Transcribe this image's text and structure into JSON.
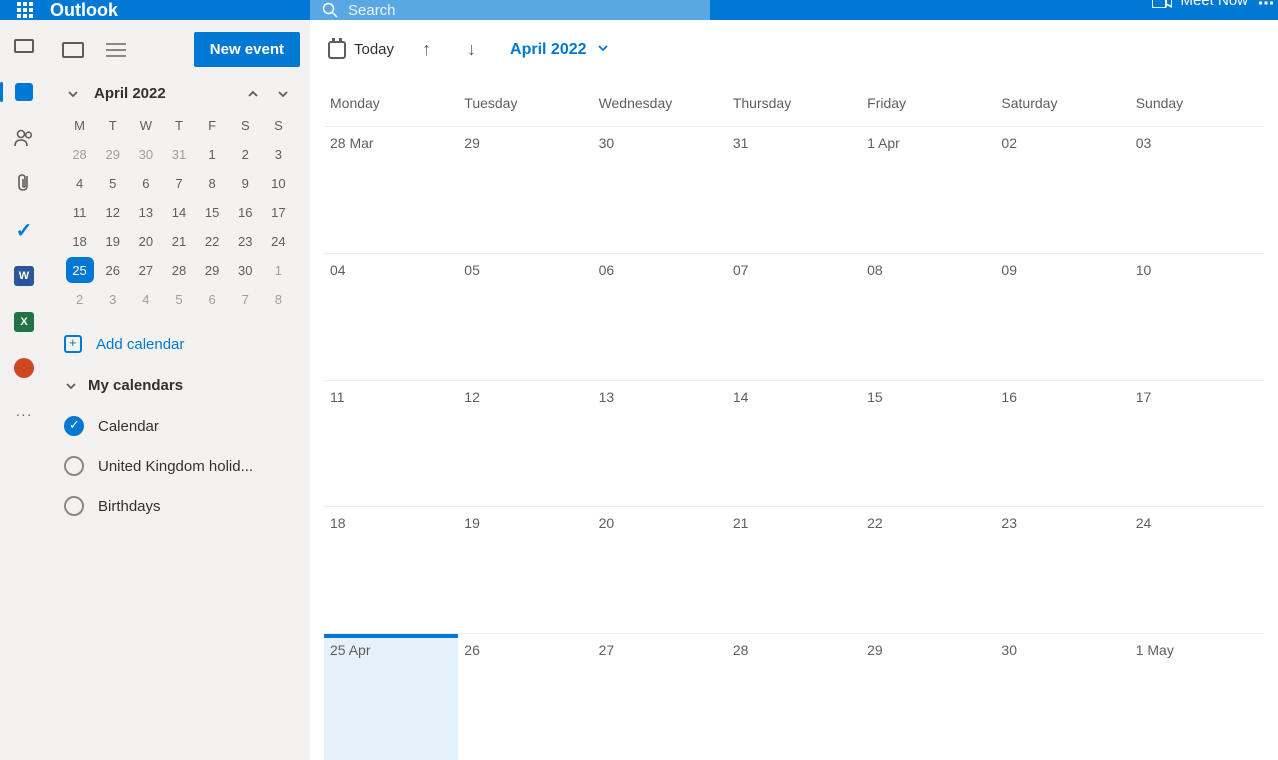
{
  "header": {
    "app_name": "Outlook",
    "search_placeholder": "Search",
    "meet_now": "Meet Now"
  },
  "rail": {
    "word": "W",
    "excel": "X",
    "more": "···"
  },
  "sidebar": {
    "new_event": "New event",
    "mini_title": "April 2022",
    "dow": [
      "M",
      "T",
      "W",
      "T",
      "F",
      "S",
      "S"
    ],
    "days": [
      {
        "d": "28",
        "out": true
      },
      {
        "d": "29",
        "out": true
      },
      {
        "d": "30",
        "out": true
      },
      {
        "d": "31",
        "out": true
      },
      {
        "d": "1"
      },
      {
        "d": "2"
      },
      {
        "d": "3"
      },
      {
        "d": "4"
      },
      {
        "d": "5"
      },
      {
        "d": "6"
      },
      {
        "d": "7"
      },
      {
        "d": "8"
      },
      {
        "d": "9"
      },
      {
        "d": "10"
      },
      {
        "d": "11"
      },
      {
        "d": "12"
      },
      {
        "d": "13"
      },
      {
        "d": "14"
      },
      {
        "d": "15"
      },
      {
        "d": "16"
      },
      {
        "d": "17"
      },
      {
        "d": "18"
      },
      {
        "d": "19"
      },
      {
        "d": "20"
      },
      {
        "d": "21"
      },
      {
        "d": "22"
      },
      {
        "d": "23"
      },
      {
        "d": "24"
      },
      {
        "d": "25",
        "today": true
      },
      {
        "d": "26"
      },
      {
        "d": "27"
      },
      {
        "d": "28"
      },
      {
        "d": "29"
      },
      {
        "d": "30"
      },
      {
        "d": "1",
        "out": true
      },
      {
        "d": "2",
        "out": true
      },
      {
        "d": "3",
        "out": true
      },
      {
        "d": "4",
        "out": true
      },
      {
        "d": "5",
        "out": true
      },
      {
        "d": "6",
        "out": true
      },
      {
        "d": "7",
        "out": true
      },
      {
        "d": "8",
        "out": true
      }
    ],
    "add_calendar": "Add calendar",
    "my_calendars": "My calendars",
    "calendars": [
      {
        "name": "Calendar",
        "checked": true
      },
      {
        "name": "United Kingdom holid...",
        "checked": false
      },
      {
        "name": "Birthdays",
        "checked": false
      }
    ]
  },
  "toolbar": {
    "today": "Today",
    "month": "April 2022"
  },
  "calendar": {
    "dow": [
      "Monday",
      "Tuesday",
      "Wednesday",
      "Thursday",
      "Friday",
      "Saturday",
      "Sunday"
    ],
    "weeks": [
      [
        {
          "lbl": "28 Mar"
        },
        {
          "lbl": "29"
        },
        {
          "lbl": "30"
        },
        {
          "lbl": "31"
        },
        {
          "lbl": "1 Apr"
        },
        {
          "lbl": "02"
        },
        {
          "lbl": "03"
        }
      ],
      [
        {
          "lbl": "04"
        },
        {
          "lbl": "05"
        },
        {
          "lbl": "06"
        },
        {
          "lbl": "07"
        },
        {
          "lbl": "08"
        },
        {
          "lbl": "09"
        },
        {
          "lbl": "10"
        }
      ],
      [
        {
          "lbl": "11"
        },
        {
          "lbl": "12"
        },
        {
          "lbl": "13"
        },
        {
          "lbl": "14"
        },
        {
          "lbl": "15"
        },
        {
          "lbl": "16"
        },
        {
          "lbl": "17"
        }
      ],
      [
        {
          "lbl": "18"
        },
        {
          "lbl": "19"
        },
        {
          "lbl": "20"
        },
        {
          "lbl": "21"
        },
        {
          "lbl": "22"
        },
        {
          "lbl": "23"
        },
        {
          "lbl": "24"
        }
      ],
      [
        {
          "lbl": "25 Apr",
          "today": true
        },
        {
          "lbl": "26"
        },
        {
          "lbl": "27"
        },
        {
          "lbl": "28"
        },
        {
          "lbl": "29"
        },
        {
          "lbl": "30"
        },
        {
          "lbl": "1 May"
        }
      ]
    ]
  }
}
